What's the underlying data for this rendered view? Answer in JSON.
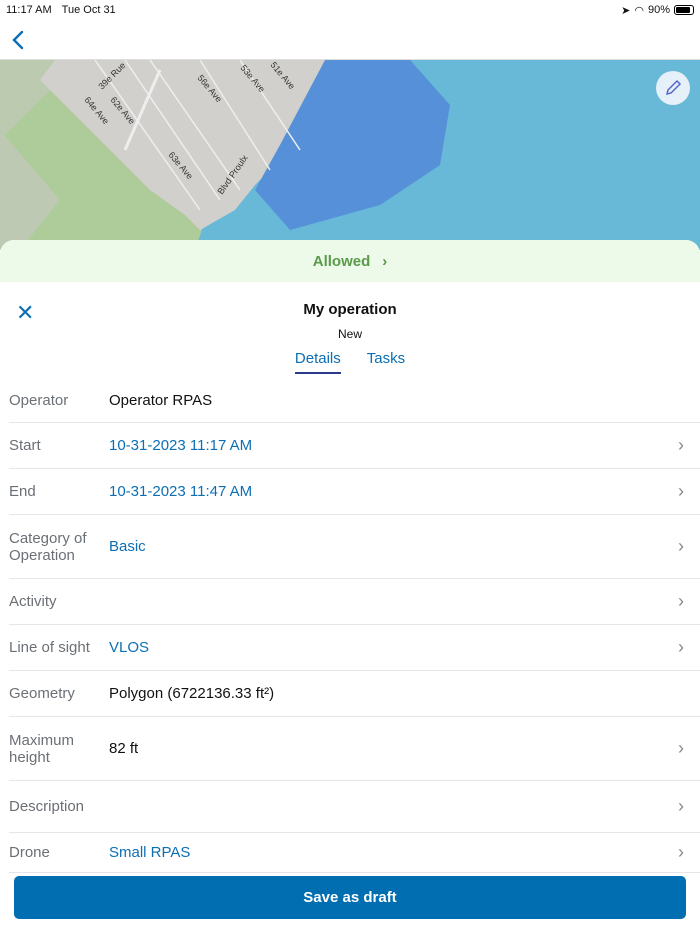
{
  "status": {
    "time": "11:17 AM",
    "date": "Tue Oct 31",
    "battery": "90%",
    "battery_level": 0.9
  },
  "map": {
    "labels": [
      "39e Rue",
      "64e Ave",
      "62e Ave",
      "56e Ave",
      "53e Ave",
      "51e Ave",
      "63e Ave",
      "Blvd Proulx"
    ]
  },
  "banner": {
    "label": "Allowed"
  },
  "header": {
    "title": "My operation",
    "subtitle": "New"
  },
  "tabs": [
    {
      "label": "Details"
    },
    {
      "label": "Tasks"
    }
  ],
  "rows": [
    {
      "label": "Operator",
      "value": "Operator RPAS"
    },
    {
      "label": "Start",
      "value": "10-31-2023 11:17 AM"
    },
    {
      "label": "End",
      "value": "10-31-2023 11:47 AM"
    },
    {
      "label": "Category of Operation",
      "value": "Basic"
    },
    {
      "label": "Activity",
      "value": ""
    },
    {
      "label": "Line of sight",
      "value": "VLOS"
    },
    {
      "label": "Geometry",
      "value": "Polygon (6722136.33 ft²)"
    },
    {
      "label": "Maximum height",
      "value": "82 ft"
    },
    {
      "label": "Description",
      "value": ""
    },
    {
      "label": "Drone",
      "value": "Small RPAS"
    }
  ],
  "footer": {
    "save_label": "Save as draft"
  }
}
